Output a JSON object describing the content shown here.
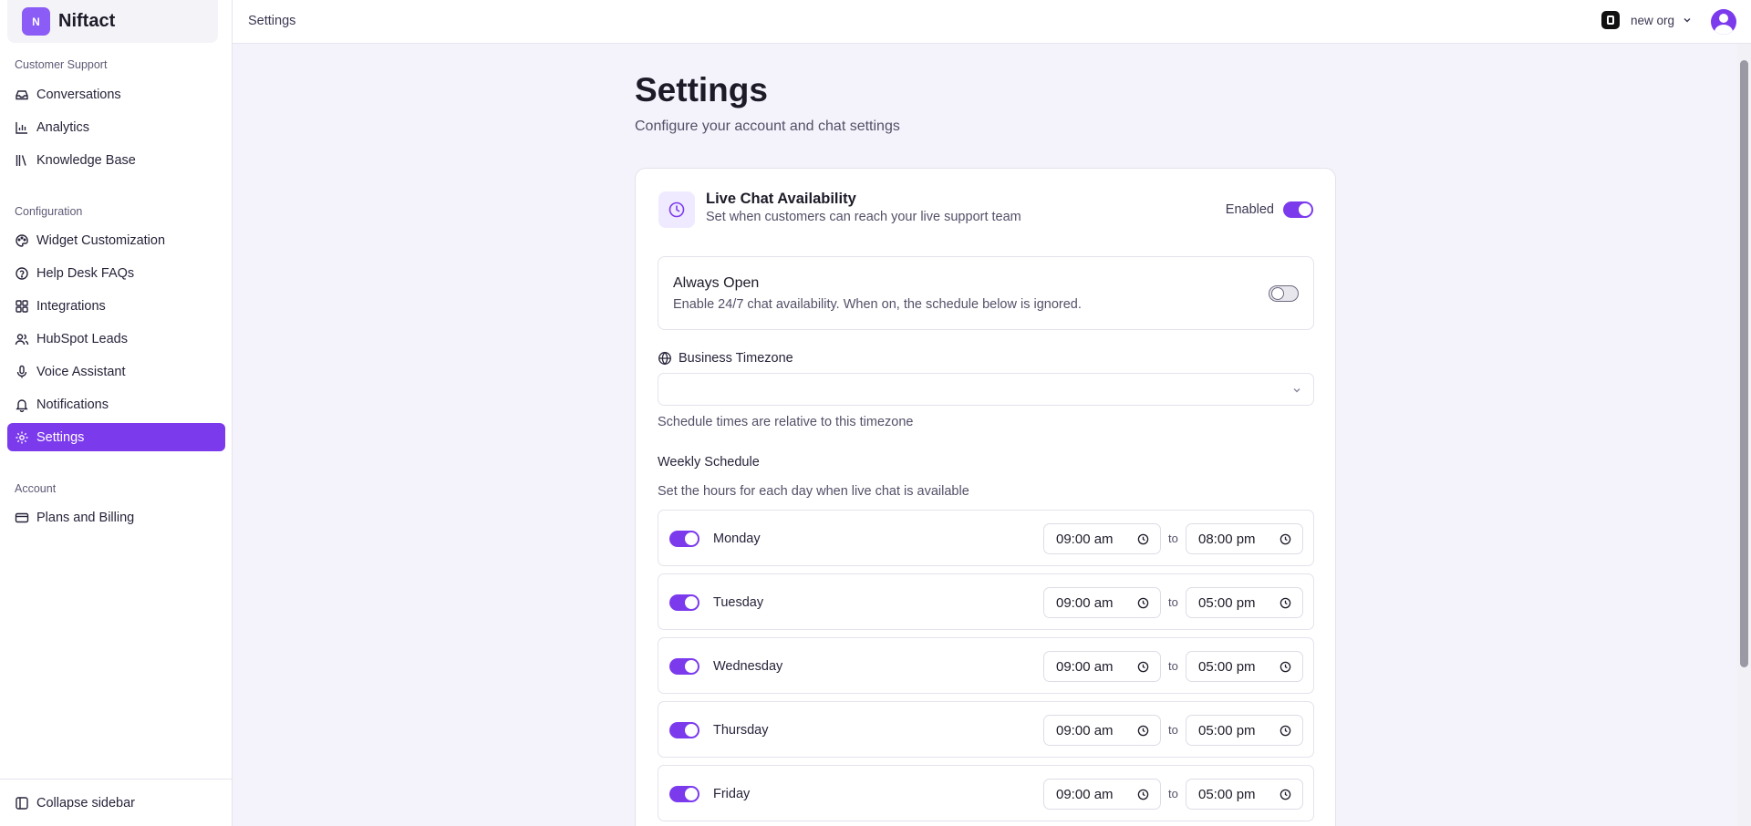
{
  "brand": {
    "logo_text": "N",
    "name": "Niftact"
  },
  "sidebar": {
    "sections": [
      {
        "title": "Customer Support"
      },
      {
        "title": "Configuration"
      },
      {
        "title": "Account"
      }
    ],
    "items": [
      {
        "label": "Conversations",
        "icon": "inbox-icon"
      },
      {
        "label": "Analytics",
        "icon": "bar-chart-icon"
      },
      {
        "label": "Knowledge Base",
        "icon": "library-icon"
      },
      {
        "label": "Widget Customization",
        "icon": "palette-icon"
      },
      {
        "label": "Help Desk FAQs",
        "icon": "help-circle-icon"
      },
      {
        "label": "Integrations",
        "icon": "grid-icon"
      },
      {
        "label": "HubSpot Leads",
        "icon": "users-icon"
      },
      {
        "label": "Voice Assistant",
        "icon": "microphone-icon"
      },
      {
        "label": "Notifications",
        "icon": "bell-icon"
      },
      {
        "label": "Settings",
        "icon": "gear-icon",
        "active": true
      },
      {
        "label": "Plans and Billing",
        "icon": "credit-card-icon"
      }
    ],
    "collapse_label": "Collapse sidebar"
  },
  "topbar": {
    "breadcrumb": "Settings",
    "org_name": "new org"
  },
  "page": {
    "title": "Settings",
    "subtitle": "Configure your account and chat settings"
  },
  "live_chat": {
    "title": "Live Chat Availability",
    "subtitle": "Set when customers can reach your live support team",
    "enabled_label": "Enabled",
    "enabled": true,
    "always_open": {
      "title": "Always Open",
      "subtitle": "Enable 24/7 chat availability. When on, the schedule below is ignored.",
      "on": false
    },
    "timezone": {
      "label": "Business Timezone",
      "value": "",
      "hint": "Schedule times are relative to this timezone"
    },
    "weekly": {
      "title": "Weekly Schedule",
      "subtitle": "Set the hours for each day when live chat is available",
      "to_label": "to",
      "days": [
        {
          "name": "Monday",
          "enabled": true,
          "from": "09:00 am",
          "to": "08:00 pm"
        },
        {
          "name": "Tuesday",
          "enabled": true,
          "from": "09:00 am",
          "to": "05:00 pm"
        },
        {
          "name": "Wednesday",
          "enabled": true,
          "from": "09:00 am",
          "to": "05:00 pm"
        },
        {
          "name": "Thursday",
          "enabled": true,
          "from": "09:00 am",
          "to": "05:00 pm"
        },
        {
          "name": "Friday",
          "enabled": true,
          "from": "09:00 am",
          "to": "05:00 pm"
        }
      ]
    }
  },
  "colors": {
    "accent": "#7c3aed",
    "brand": "#8b5cf6"
  }
}
